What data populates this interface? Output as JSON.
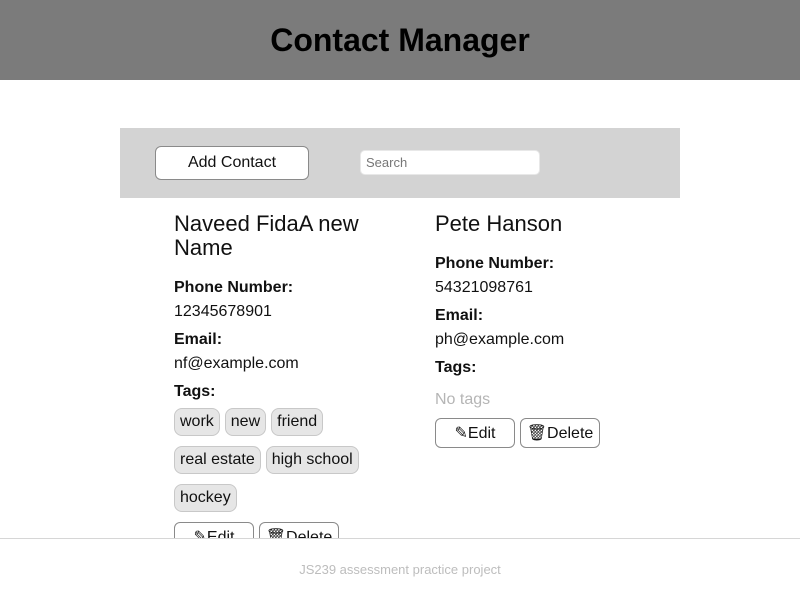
{
  "header": {
    "title": "Contact Manager"
  },
  "toolbar": {
    "add_label": "Add Contact",
    "search_placeholder": "Search"
  },
  "labels": {
    "phone": "Phone Number:",
    "email": "Email:",
    "tags": "Tags:",
    "no_tags": "No tags",
    "edit": "✎Edit",
    "delete": "🗑Delete"
  },
  "contacts": [
    {
      "name": "Naveed FidaA new Name",
      "phone": "12345678901",
      "email": "nf@example.com",
      "tags": [
        "work",
        "new",
        "friend",
        "real estate",
        "high school",
        "hockey"
      ]
    },
    {
      "name": "Pete Hanson",
      "phone": "54321098761",
      "email": "ph@example.com",
      "tags": []
    }
  ],
  "footer": {
    "text": "JS239 assessment practice project"
  },
  "colors": {
    "header_bg": "#7b7b7b",
    "toolbar_bg": "#d3d3d3",
    "tag_bg": "#e6e6e6",
    "muted_text": "#b5b5b5"
  },
  "icons": {
    "edit": "pencil-icon",
    "delete": "trash-icon"
  }
}
